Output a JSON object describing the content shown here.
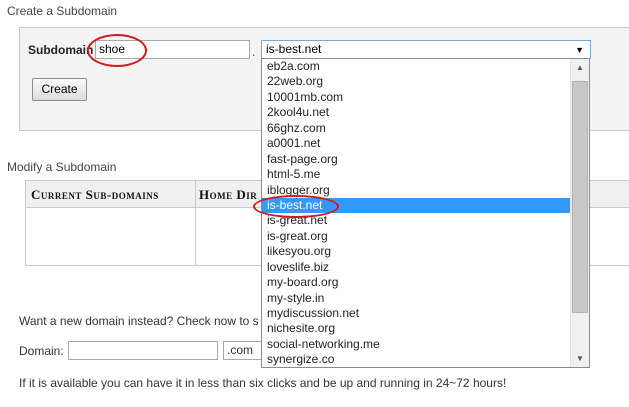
{
  "create_section": {
    "title": "Create a Subdomain",
    "subdomain_label": "Subdomain",
    "colon": ":",
    "subdomain_value": "shoe",
    "dot": ".",
    "selected_domain": "is-best.net",
    "create_button": "Create"
  },
  "modify_section": {
    "title": "Modify a Subdomain",
    "columns": [
      "Current Sub-domains",
      "Home Directory"
    ],
    "columns_visible": [
      "Current Sub-domains",
      "Home Dir"
    ]
  },
  "dropdown": {
    "options": [
      "eb2a.com",
      "22web.org",
      "10001mb.com",
      "2kool4u.net",
      "66ghz.com",
      "a0001.net",
      "fast-page.org",
      "html-5.me",
      "iblogger.org",
      "is-best.net",
      "is-great.net",
      "is-great.org",
      "likesyou.org",
      "loveslife.biz",
      "my-board.org",
      "my-style.in",
      "mydiscussion.net",
      "nichesite.org",
      "social-networking.me",
      "synergize.co"
    ],
    "selected_index": 9
  },
  "new_domain": {
    "prompt": "Want a new domain instead? Check now to s",
    "domain_label": "Domain:",
    "domain_value": "",
    "tld_value": ".com",
    "footer": "If it is available you can have it in less than six clicks and be up and running in 24~72 hours!"
  },
  "colors": {
    "annotation_red": "#d11a1a",
    "selection_blue": "#3399ff"
  }
}
